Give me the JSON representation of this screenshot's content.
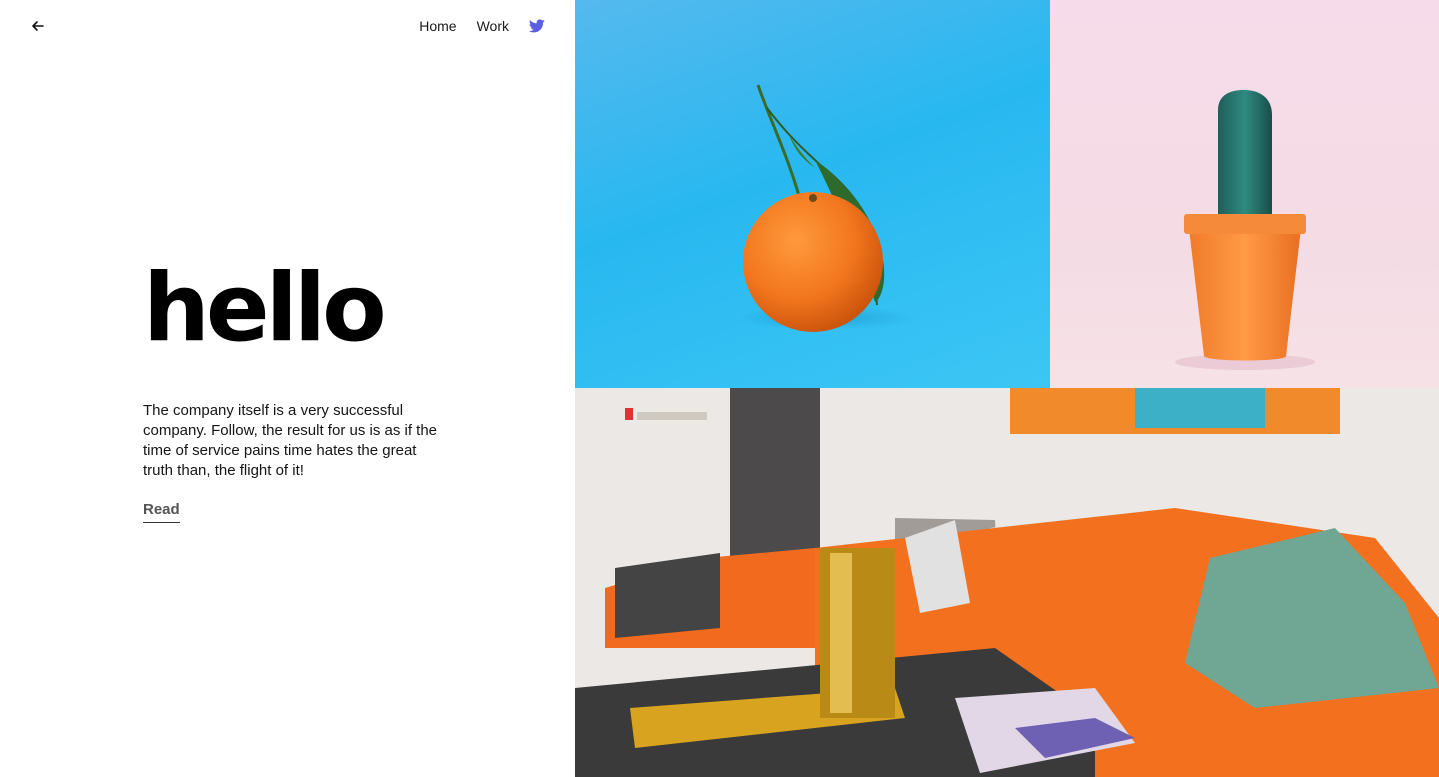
{
  "nav": {
    "back_label": "back",
    "items": [
      {
        "label": "Home"
      },
      {
        "label": "Work"
      }
    ],
    "social_icon": "twitter-icon",
    "social_color": "#5b5fe0"
  },
  "hero": {
    "title": "hello",
    "body": "The company itself is a very successful company. Follow, the result for us is as if the time of service pains time hates the great truth than, the flight of it!",
    "cta": "Read"
  },
  "gallery": {
    "images": [
      {
        "subject": "orange-on-blue",
        "bg": "#2eb6ef"
      },
      {
        "subject": "cactus-in-pot",
        "bg": "#f5dde7"
      },
      {
        "subject": "orange-sofa-living-room",
        "bg": "#e9e6e3"
      }
    ]
  }
}
